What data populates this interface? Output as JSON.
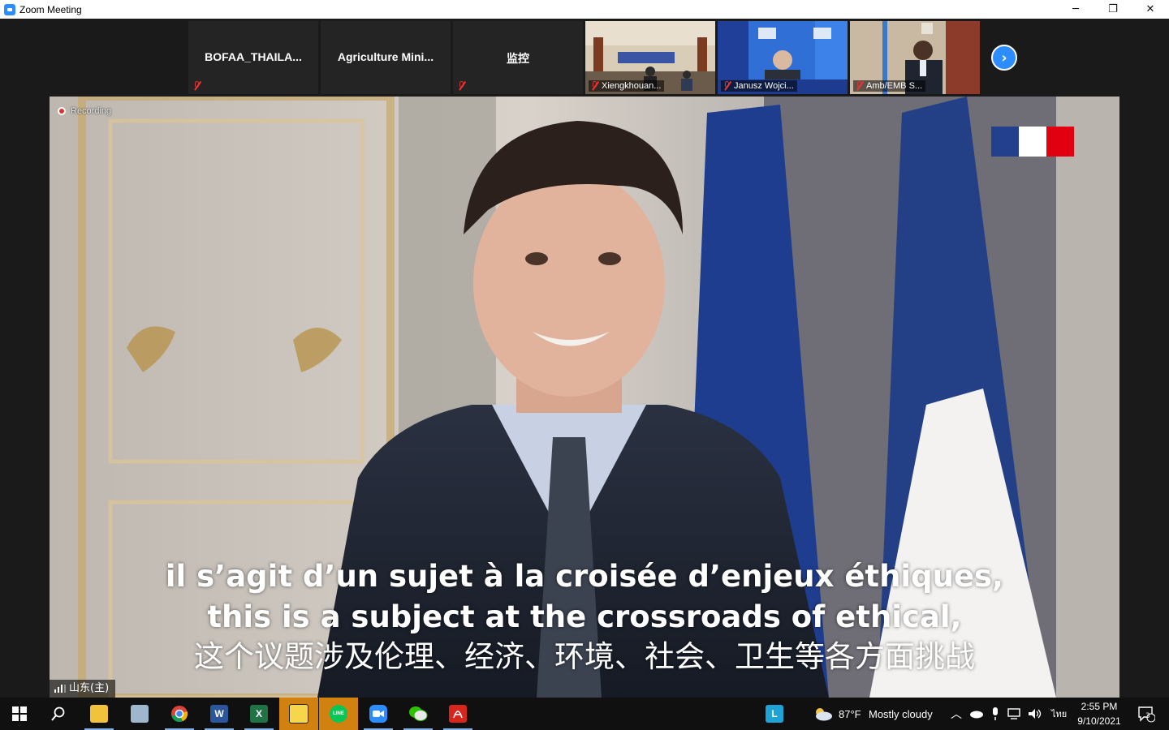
{
  "window": {
    "title": "Zoom Meeting",
    "minimize_glyph": "─",
    "restore_glyph": "❐",
    "close_glyph": "✕"
  },
  "participants": [
    {
      "name": "BOFAA_THAILA...",
      "video": false,
      "muted": true
    },
    {
      "name": "Agriculture  Mini...",
      "video": false,
      "muted": false
    },
    {
      "name": "监控",
      "video": false,
      "muted": true
    },
    {
      "name": "Xiengkhouan...",
      "video": true,
      "muted": true
    },
    {
      "name": "Janusz Wojci...",
      "video": true,
      "muted": true
    },
    {
      "name": "Amb/EMB S...",
      "video": true,
      "muted": true
    }
  ],
  "strip_next_glyph": "›",
  "main_video": {
    "recording_label": "Recording",
    "captions": [
      "il s’agit d’un sujet à la croisée d’enjeux éthiques,",
      "this is a subject at the crossroads of ethical,",
      "这个议题涉及伦理、经济、环境、社会、卫生等各方面挑战"
    ],
    "speaker_name": "山东(主)"
  },
  "taskbar": {
    "apps": [
      {
        "name": "file-explorer",
        "color": "#f2c23a",
        "running": true
      },
      {
        "name": "notepad",
        "color": "#9fb7cc",
        "running": false
      },
      {
        "name": "chrome",
        "color": "#4285f4",
        "running": true
      },
      {
        "name": "word",
        "color": "#2b579a",
        "letter": "W",
        "running": true
      },
      {
        "name": "excel",
        "color": "#217346",
        "letter": "X",
        "running": true
      },
      {
        "name": "sticky-notes",
        "color": "#f7d64a",
        "running": true,
        "active": true
      },
      {
        "name": "line",
        "color": "#06c755",
        "letter": "LINE",
        "running": true,
        "active": true
      },
      {
        "name": "zoom",
        "color": "#2d8cff",
        "running": true
      },
      {
        "name": "wechat",
        "color": "#2dc100",
        "running": true
      },
      {
        "name": "acrobat",
        "color": "#d7261e",
        "running": true
      }
    ],
    "pinned_l_letter": "L",
    "weather_temp": "87°F",
    "weather_desc": "Mostly cloudy",
    "input_lang": "ไทย",
    "time": "2:55 PM",
    "date": "9/10/2021",
    "notification_count": "3",
    "colors": {
      "accent_active": "#d0810f",
      "background": "#101010"
    }
  }
}
